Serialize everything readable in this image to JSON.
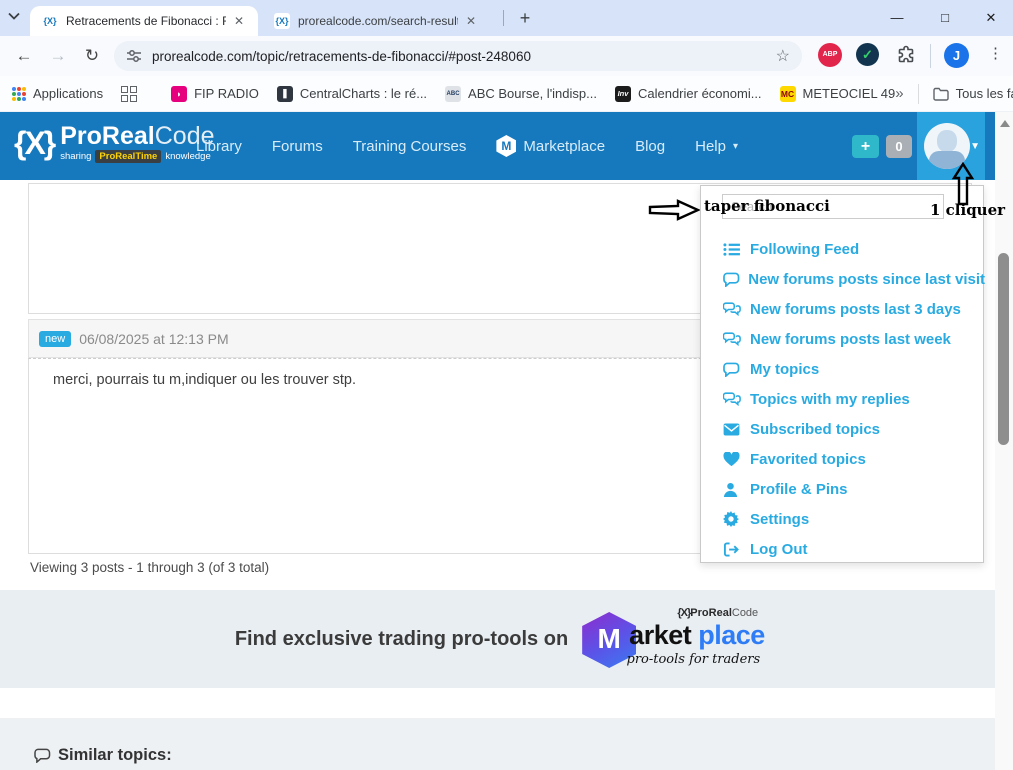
{
  "colors": {
    "accent": "#29abe2",
    "header_blue": "#1779bd"
  },
  "browser": {
    "tabs": [
      {
        "title": "Retracements de Fibonacci : For",
        "active": true
      },
      {
        "title": "prorealcode.com/search-results",
        "active": false
      }
    ],
    "url": "prorealcode.com/topic/retracements-de-fibonacci/#post-248060",
    "abp_badge": "ABP",
    "profile_initial": "J",
    "apps_label": "Applications",
    "bookmarks": [
      {
        "icon": "fip",
        "badge": "◗",
        "label": "FIP RADIO"
      },
      {
        "icon": "cc",
        "badge": "❚",
        "label": "CentralCharts : le ré..."
      },
      {
        "icon": "abc",
        "badge": "ABC",
        "label": "ABC Bourse, l'indisp..."
      },
      {
        "icon": "inv",
        "badge": "Inv",
        "label": "Calendrier économi..."
      },
      {
        "icon": "mc",
        "badge": "MC",
        "label": "METEOCIEL 49"
      }
    ],
    "all_favorites": "Tous les favoris"
  },
  "site_header": {
    "logo_glyph": "{X}",
    "brand_pro": "ProReal",
    "brand_code": "Code",
    "tagline_prefix": "sharing",
    "tagline_brand": "ProRealTime",
    "tagline_suffix": "knowledge",
    "nav": [
      {
        "icon": "",
        "label": "Library"
      },
      {
        "icon": "",
        "label": "Forums"
      },
      {
        "icon": "",
        "label": "Training Courses"
      },
      {
        "icon": "marketplace-hex",
        "label": "Marketplace"
      },
      {
        "icon": "",
        "label": "Blog"
      },
      {
        "icon": "",
        "label": "Help",
        "caret": "▾"
      }
    ],
    "add_button": "+",
    "counter": "0"
  },
  "user_menu": {
    "search_placeholder": "Search",
    "items": [
      {
        "icon": "list",
        "label": "Following Feed"
      },
      {
        "icon": "comment",
        "label": "New forums posts since last visit"
      },
      {
        "icon": "comments",
        "label": "New forums posts last 3 days"
      },
      {
        "icon": "comments",
        "label": "New forums posts last week"
      },
      {
        "icon": "comment",
        "label": "My topics"
      },
      {
        "icon": "comments",
        "label": "Topics with my replies"
      },
      {
        "icon": "envelope",
        "label": "Subscribed topics"
      },
      {
        "icon": "heart",
        "label": "Favorited topics"
      },
      {
        "icon": "user",
        "label": "Profile & Pins"
      },
      {
        "icon": "gear",
        "label": "Settings"
      },
      {
        "icon": "logout",
        "label": "Log Out"
      }
    ]
  },
  "annotations": {
    "search_hint": "taper fibonacci",
    "avatar_hint": "1 cliquer"
  },
  "post": {
    "badge": "new",
    "date": "06/08/2025 at 12:13 PM",
    "content": "merci, pourrais tu m,indiquer ou les trouver  stp.",
    "viewing": "Viewing 3 posts - 1 through 3 (of 3 total)"
  },
  "banner": {
    "text": "Find exclusive trading pro-tools on",
    "logo_brand_icon": "{X}",
    "logo_brand_pro": "ProReal",
    "logo_brand_code": "Code",
    "logo_m": "M",
    "logo_market": "arket",
    "logo_place": "place",
    "logo_subtitle": "pro-tools for traders"
  },
  "footer": {
    "similar_topics": "Similar topics:"
  }
}
